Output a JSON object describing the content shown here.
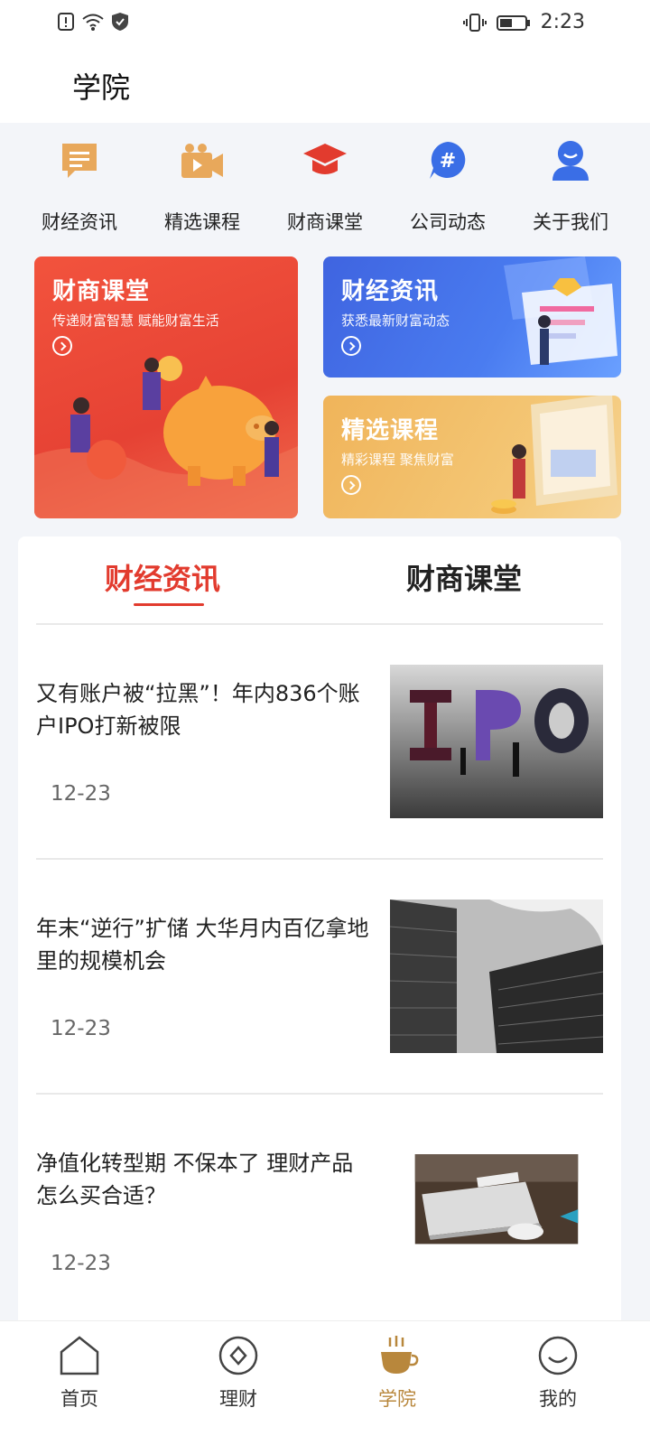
{
  "status_bar": {
    "time": "2:23",
    "icons": [
      "alert-icon",
      "wifi-icon",
      "shield-icon",
      "vibrate-icon",
      "battery-icon"
    ]
  },
  "header": {
    "title": "学院"
  },
  "quick_nav": [
    {
      "label": "财经资讯",
      "icon": "message-icon",
      "color": "#e6a75a"
    },
    {
      "label": "精选课程",
      "icon": "video-icon",
      "color": "#e6a75a"
    },
    {
      "label": "财商课堂",
      "icon": "graduation-cap-icon",
      "color": "#e23b2e"
    },
    {
      "label": "公司动态",
      "icon": "hashtag-icon",
      "color": "#3a6ee6"
    },
    {
      "label": "关于我们",
      "icon": "user-icon",
      "color": "#3a6ee6"
    }
  ],
  "banners": {
    "red": {
      "title": "财商课堂",
      "subtitle": "传递财富智慧  赋能财富生活"
    },
    "blue": {
      "title": "财经资讯",
      "subtitle": "获悉最新财富动态"
    },
    "yellow": {
      "title": "精选课程",
      "subtitle": "精彩课程  聚焦财富"
    }
  },
  "tabs": {
    "active": "财经资讯",
    "inactive": "财商课堂"
  },
  "articles": [
    {
      "title": "又有账户被“拉黑”！年内836个账户IPO打新被限",
      "date": "12-23",
      "thumb": "ipo-image"
    },
    {
      "title": "年末“逆行”扩储 大华月内百亿拿地里的规模机会",
      "date": "12-23",
      "thumb": "buildings-image"
    },
    {
      "title": "净值化转型期 不保本了 理财产品怎么买合适？",
      "date": "12-23",
      "thumb": "laptop-image"
    }
  ],
  "bottom_nav": [
    {
      "label": "首页",
      "icon": "home-icon"
    },
    {
      "label": "理财",
      "icon": "diamond-circle-icon"
    },
    {
      "label": "学院",
      "icon": "coffee-cup-icon",
      "active": true
    },
    {
      "label": "我的",
      "icon": "smile-icon"
    }
  ],
  "colors": {
    "accent_red": "#e23b2e",
    "accent_gold": "#b8873c",
    "accent_blue": "#3a6ee6"
  }
}
